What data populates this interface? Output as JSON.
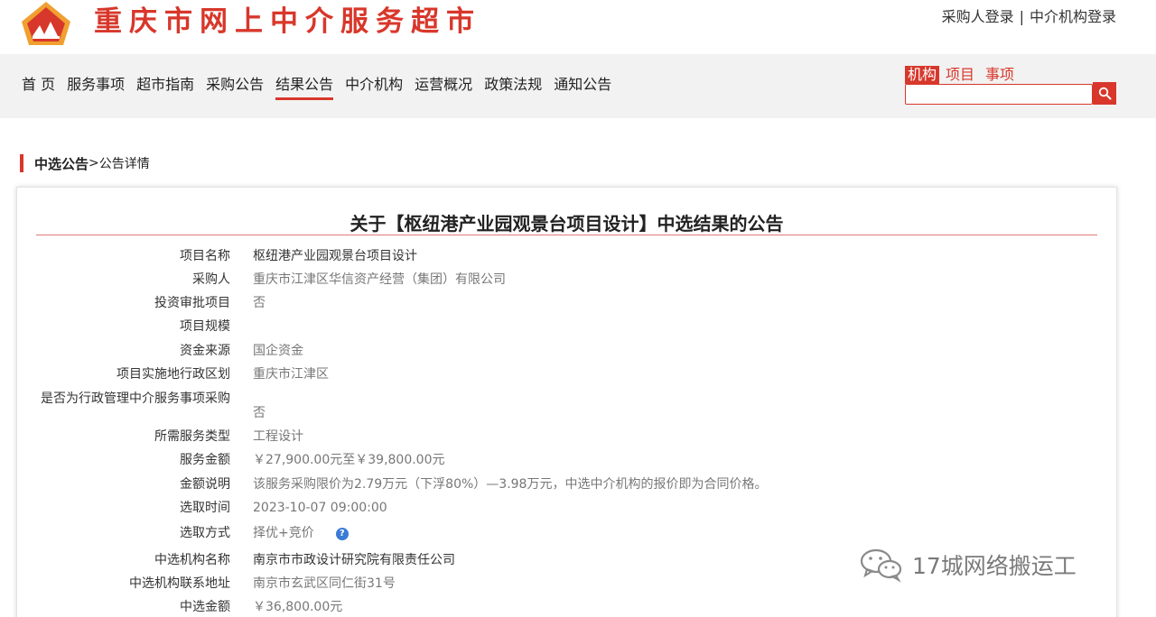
{
  "header": {
    "site_title": "重庆市网上中介服务超市",
    "buyer_login": "采购人登录",
    "separator": "|",
    "agency_login": "中介机构登录"
  },
  "nav": {
    "items": [
      {
        "label": "首 页"
      },
      {
        "label": "服务事项"
      },
      {
        "label": "超市指南"
      },
      {
        "label": "采购公告"
      },
      {
        "label": "结果公告"
      },
      {
        "label": "中介机构"
      },
      {
        "label": "运营概况"
      },
      {
        "label": "政策法规"
      },
      {
        "label": "通知公告"
      }
    ],
    "active_index": 4
  },
  "search": {
    "tabs": [
      {
        "label": "机构"
      },
      {
        "label": "项目"
      },
      {
        "label": "事项"
      }
    ],
    "active_tab": 0,
    "placeholder": "",
    "icon": "search-icon"
  },
  "breadcrumb": {
    "parent": "中选公告",
    "separator": ">",
    "current": "公告详情"
  },
  "announcement": {
    "title": "关于【枢纽港产业园观景台项目设计】中选结果的公告",
    "fields": [
      {
        "label": "项目名称",
        "value": "枢纽港产业园观景台项目设计"
      },
      {
        "label": "采购人",
        "value": "重庆市江津区华信资产经营（集团）有限公司"
      },
      {
        "label": "投资审批项目",
        "value": "否"
      },
      {
        "label": "项目规模",
        "value": ""
      },
      {
        "label": "资金来源",
        "value": "国企资金"
      },
      {
        "label": "项目实施地行政区划",
        "value": "重庆市江津区"
      },
      {
        "label": "是否为行政管理中介服务事项采购",
        "value": "否"
      },
      {
        "label": "所需服务类型",
        "value": "工程设计"
      },
      {
        "label": "服务金额",
        "value": "￥27,900.00元至￥39,800.00元"
      },
      {
        "label": "金额说明",
        "value": "该服务采购限价为2.79万元（下浮80%）—3.98万元，中选中介机构的报价即为合同价格。"
      },
      {
        "label": "选取时间",
        "value": "2023-10-07 09:00:00"
      },
      {
        "label": "选取方式",
        "value": "择优+竞价"
      },
      {
        "label": "中选机构名称",
        "value": "南京市市政设计研究院有限责任公司"
      },
      {
        "label": "中选机构联系地址",
        "value": "南京市玄武区同仁街31号"
      },
      {
        "label": "中选金额",
        "value": "￥36,800.00元"
      }
    ]
  },
  "watermark": {
    "text": "17城网络搬运工"
  },
  "colors": {
    "brand_red": "#d8372b",
    "logo_orange": "#f0a030",
    "nav_bg": "#f2f2f2",
    "help_blue": "#3a7bd5"
  }
}
